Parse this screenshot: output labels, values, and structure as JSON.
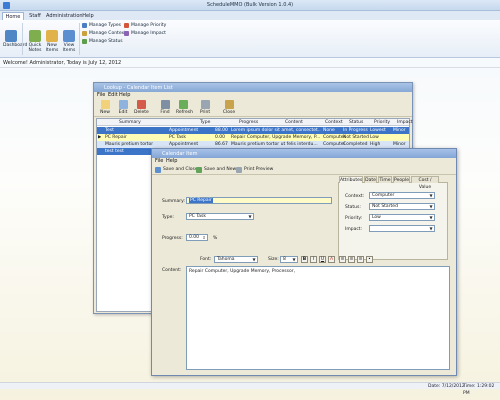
{
  "app": {
    "title": "ScheduleMMO (Bulk Version 1.0.4)"
  },
  "ribbon": {
    "tabs": [
      "Home",
      "Staff",
      "Administration",
      "Help"
    ],
    "buttons": [
      "Dashboard",
      "Quick Notes",
      "New Items",
      "View Items"
    ],
    "small": [
      "Manage Types",
      "Manage Context",
      "Manage Status",
      "Manage Priority",
      "Manage Impact"
    ]
  },
  "welcome": "Welcome! Administrator, Today is July 12, 2012",
  "lookup": {
    "title": "Lookup - Calendar Item List",
    "menu": [
      "File",
      "Edit",
      "Help"
    ],
    "toolbar": [
      "New",
      "Edit",
      "Delete",
      "Find",
      "Refresh",
      "Print",
      "Close"
    ],
    "columns": [
      "Summary",
      "Type",
      "Progress",
      "Content",
      "Context",
      "Status",
      "Priority",
      "Impact"
    ],
    "rows": [
      [
        "Test",
        "Appointment",
        "88.00",
        "Lorem ipsum dolor sit amet, consectet...",
        "None",
        "In Progress",
        "Lowest",
        "Minor"
      ],
      [
        "PC Repair",
        "PC Task",
        "0.00",
        "Repair Computer, Upgrade Memory, P...",
        "Computer",
        "Not Started",
        "Low",
        ""
      ],
      [
        "Mauris pretium tortor",
        "Appointment",
        "86.67",
        "Mauris pretium tortor ut felis interdu...",
        "Computer",
        "Completed",
        "High",
        "Minor"
      ],
      [
        "test test",
        "",
        "",
        "",
        "",
        "",
        "",
        ""
      ]
    ]
  },
  "calendar": {
    "title": "Calendar Item",
    "menu": [
      "File",
      "Help"
    ],
    "toolbar": [
      "Save and Close",
      "Save and New",
      "Print Preview"
    ],
    "summary_label": "Summary:",
    "summary_value": "PC Repair",
    "type_label": "Type:",
    "type_value": "PC Task",
    "progress_label": "Progress:",
    "progress_value": "0.00",
    "progress_unit": "%",
    "tabs": [
      "Attributes",
      "Date",
      "Time",
      "People",
      "Cost / Value"
    ],
    "context_label": "Context:",
    "context_value": "Computer",
    "status_label": "Status:",
    "status_value": "Not Started",
    "priority_label": "Priority:",
    "priority_value": "Low",
    "impact_label": "Impact:",
    "impact_value": "",
    "font_label": "Font:",
    "font_value": "Tahoma",
    "size_label": "Size:",
    "size_value": "8",
    "format_buttons": [
      "B",
      "I",
      "U",
      "A"
    ],
    "content_label": "Content:",
    "content_value": "Repair Computer, Upgrade Memory, Processor,"
  },
  "status_bar": {
    "date": "Date: 7/12/2012",
    "time": "Time: 1:29:02 PM"
  }
}
